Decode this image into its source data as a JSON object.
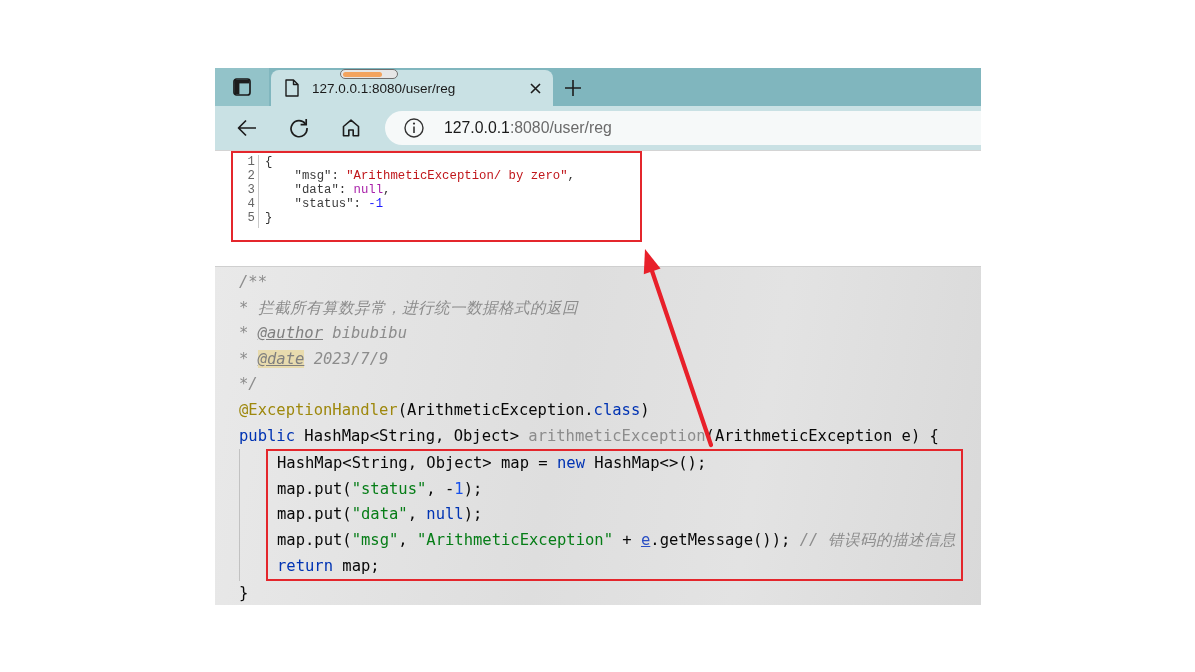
{
  "browser": {
    "tabs": [
      {
        "title": "127.0.0.1:8080/user/reg",
        "selected": true
      }
    ],
    "progress": {
      "level": 0.75
    },
    "address": {
      "host": "127.0.0.1",
      "path": ":8080/user/reg"
    }
  },
  "json_viewer": {
    "highlighted": true,
    "lines": [
      {
        "number": "1",
        "tokens": [
          {
            "kind": "punct",
            "text": "{"
          }
        ]
      },
      {
        "number": "2",
        "tokens": [
          {
            "kind": "key",
            "text": "    \"msg\""
          },
          {
            "kind": "punct",
            "text": ": "
          },
          {
            "kind": "json_string",
            "text": "\"ArithmeticException/ by zero\""
          },
          {
            "kind": "punct",
            "text": ","
          }
        ]
      },
      {
        "number": "3",
        "tokens": [
          {
            "kind": "key",
            "text": "    \"data\""
          },
          {
            "kind": "punct",
            "text": ": "
          },
          {
            "kind": "literal",
            "text": "null"
          },
          {
            "kind": "punct",
            "text": ","
          }
        ]
      },
      {
        "number": "4",
        "tokens": [
          {
            "kind": "key",
            "text": "    \"status\""
          },
          {
            "kind": "punct",
            "text": ": "
          },
          {
            "kind": "json_number",
            "text": "-1"
          }
        ]
      },
      {
        "number": "5",
        "tokens": [
          {
            "kind": "punct",
            "text": "}"
          }
        ]
      }
    ]
  },
  "code_editor": {
    "header_lines": [
      {
        "tokens": [
          {
            "kind": "comment",
            "text": "/**"
          }
        ]
      },
      {
        "tokens": [
          {
            "kind": "comment",
            "text": "* 拦截所有算数异常，进行统一数据格式的返回"
          }
        ]
      },
      {
        "tokens": [
          {
            "kind": "comment",
            "text": "* "
          },
          {
            "kind": "doc_tag",
            "text": "@author"
          },
          {
            "kind": "comment",
            "text": " bibubibu"
          }
        ]
      },
      {
        "tokens": [
          {
            "kind": "comment",
            "text": "* "
          },
          {
            "kind": "doc_tag_marked",
            "text": "@date"
          },
          {
            "kind": "comment",
            "text": " 2023/7/9"
          }
        ]
      },
      {
        "tokens": [
          {
            "kind": "comment",
            "text": "*/"
          }
        ]
      },
      {
        "tokens": [
          {
            "kind": "annotation",
            "text": "@ExceptionHandler"
          },
          {
            "kind": "plain",
            "text": "(ArithmeticException."
          },
          {
            "kind": "keyword",
            "text": "class"
          },
          {
            "kind": "plain",
            "text": ")"
          }
        ]
      },
      {
        "tokens": [
          {
            "kind": "keyword",
            "text": "public"
          },
          {
            "kind": "plain",
            "text": " HashMap<String, Object> "
          },
          {
            "kind": "unused",
            "text": "arithmeticException"
          },
          {
            "kind": "plain",
            "text": "(ArithmeticException e) {"
          }
        ]
      }
    ],
    "body": {
      "highlighted": true,
      "lines": [
        {
          "tokens": [
            {
              "kind": "plain",
              "text": "HashMap<String, Object> map = "
            },
            {
              "kind": "keyword",
              "text": "new"
            },
            {
              "kind": "plain",
              "text": " HashMap<>();"
            }
          ]
        },
        {
          "tokens": [
            {
              "kind": "plain",
              "text": "map.put("
            },
            {
              "kind": "string",
              "text": "\"status\""
            },
            {
              "kind": "plain",
              "text": ", -"
            },
            {
              "kind": "number",
              "text": "1"
            },
            {
              "kind": "plain",
              "text": ");"
            }
          ]
        },
        {
          "tokens": [
            {
              "kind": "plain",
              "text": "map.put("
            },
            {
              "kind": "string",
              "text": "\"data\""
            },
            {
              "kind": "plain",
              "text": ", "
            },
            {
              "kind": "keyword",
              "text": "null"
            },
            {
              "kind": "plain",
              "text": ");"
            }
          ]
        },
        {
          "tokens": [
            {
              "kind": "plain",
              "text": "map.put("
            },
            {
              "kind": "string",
              "text": "\"msg\""
            },
            {
              "kind": "plain",
              "text": ", "
            },
            {
              "kind": "string",
              "text": "\"ArithmeticException\""
            },
            {
              "kind": "plain",
              "text": " + "
            },
            {
              "kind": "param_ref",
              "text": "e"
            },
            {
              "kind": "plain",
              "text": ".getMessage()); "
            },
            {
              "kind": "comment",
              "text": "// 错误码的描述信息"
            }
          ]
        },
        {
          "tokens": [
            {
              "kind": "keyword",
              "text": "return"
            },
            {
              "kind": "plain",
              "text": " map;"
            }
          ]
        }
      ]
    },
    "footer_lines": [
      {
        "tokens": [
          {
            "kind": "plain",
            "text": "}"
          }
        ]
      }
    ]
  }
}
